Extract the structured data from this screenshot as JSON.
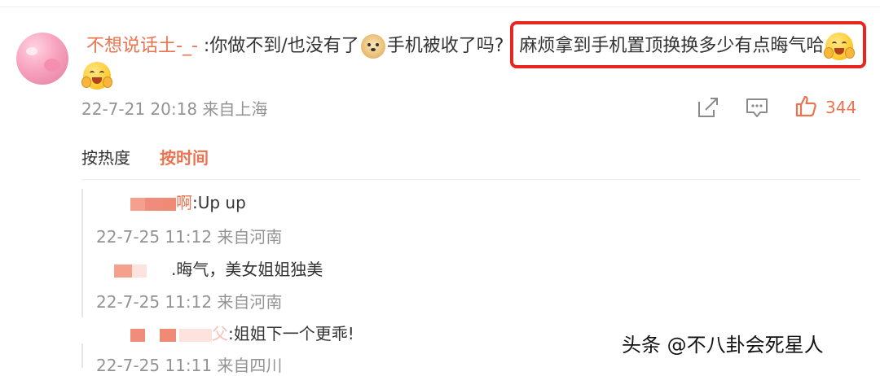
{
  "comment": {
    "username": "不想说话土-_-",
    "text_part1": ":你做不到/也没有了",
    "text_part2": "手机被收了吗?",
    "highlighted_text": "麻烦拿到手机置顶换换多少有点晦气哈",
    "emoji_1": "doge-icon",
    "emoji_2": "grin-hug-icon",
    "meta": "22-7-21 20:18 来自上海",
    "like_count": "344"
  },
  "sort": {
    "by_heat": "按热度",
    "by_time": "按时间"
  },
  "replies": [
    {
      "name_tail": "啊",
      "text": ":Up up",
      "meta": "22-7-25 11:12 来自河南"
    },
    {
      "text": ".晦气，美女姐姐独美",
      "meta": "22-7-25 11:12 来自河南"
    },
    {
      "name_tail": "父",
      "text": ":姐姐下一个更乖!",
      "meta": "22-7-25 11:11 来自四川"
    }
  ],
  "watermark": "头条 @不八卦会死星人",
  "colors": {
    "accent": "#eb7350",
    "highlight_border": "#e8261f",
    "meta_gray": "#939393"
  }
}
